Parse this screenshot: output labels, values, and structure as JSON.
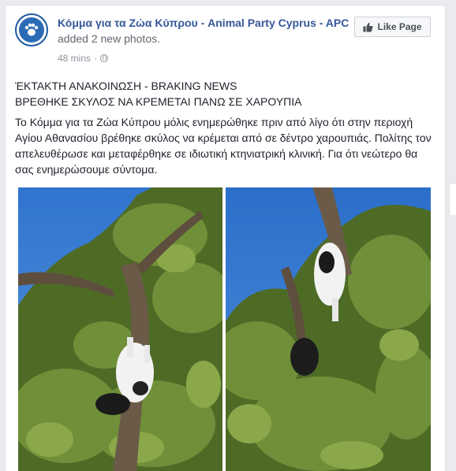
{
  "post": {
    "page_name": "Κόμμα για τα Ζώα Κύπρου - Animal Party Cyprus - APC",
    "action": " added 2 new photos.",
    "timestamp": "48 mins",
    "separator": "·",
    "privacy_icon": "globe-icon",
    "like_button": {
      "label": "Like Page",
      "icon": "thumbs-up-icon"
    },
    "headline_line1": "ΈΚΤΑΚΤΗ ΑΝΑΚΟΙΝΩΣΗ - BRAKING NEWS",
    "headline_line2": "ΒΡΕΘΗΚΕ ΣΚΥΛΟΣ ΝΑ ΚΡΕΜΕΤΑΙ ΠΑΝΩ ΣΕ ΧΑΡΟΥΠΙΑ",
    "body": "Το Κόμμα για τα Ζώα Κύπρου μόλις ενημερώθηκε πριν από λίγο ότι στην περιοχή Αγίου Αθανασίου βρέθηκε σκύλος να κρέμεται από σε δέντρο χαρουπιάς. Πολίτης τον απελευθέρωσε και μεταφέρθηκε σε ιδιωτική κτηνιατρική κλινική. Για ότι νεώτερο θα σας ενημερώσουμε σύντομα."
  },
  "colors": {
    "link": "#365899",
    "text": "#1d2129",
    "meta": "#90949c",
    "sky": "#3a7fd6",
    "foliage": "#5c7a2e"
  }
}
